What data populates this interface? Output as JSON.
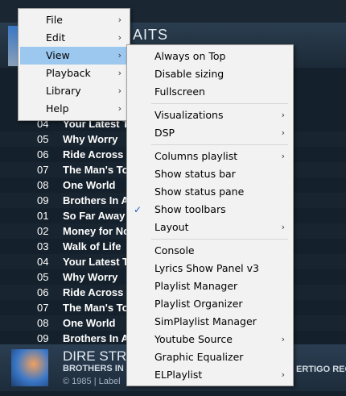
{
  "background": {
    "album_title": "AITS",
    "rows": [
      {
        "num": "04",
        "title": "Your Latest T"
      },
      {
        "num": "05",
        "title": "Why Worry"
      },
      {
        "num": "06",
        "title": "Ride Across T"
      },
      {
        "num": "07",
        "title": "The Man's To"
      },
      {
        "num": "08",
        "title": "One World"
      },
      {
        "num": "09",
        "title": "Brothers In A"
      },
      {
        "num": "01",
        "title": "So Far Away"
      },
      {
        "num": "02",
        "title": "Money for No"
      },
      {
        "num": "03",
        "title": "Walk of Life"
      },
      {
        "num": "04",
        "title": "Your Latest T"
      },
      {
        "num": "05",
        "title": "Why Worry"
      },
      {
        "num": "06",
        "title": "Ride Across T"
      },
      {
        "num": "07",
        "title": "The Man's To"
      },
      {
        "num": "08",
        "title": "One World"
      },
      {
        "num": "09",
        "title": "Brothers In A"
      }
    ],
    "footer": {
      "artist": "DIRE STR",
      "album": "BROTHERS IN",
      "copyright": "© 1985 | Label",
      "label": "ERTIGO RECO"
    }
  },
  "main_menu": {
    "items": [
      {
        "label": "File",
        "arrow": "›"
      },
      {
        "label": "Edit",
        "arrow": "›"
      },
      {
        "label": "View",
        "arrow": "›",
        "selected": true
      },
      {
        "label": "Playback",
        "arrow": "›"
      },
      {
        "label": "Library",
        "arrow": "›"
      },
      {
        "label": "Help",
        "arrow": "›"
      }
    ]
  },
  "view_menu": {
    "items": [
      {
        "label": "Always on Top"
      },
      {
        "label": "Disable sizing"
      },
      {
        "label": "Fullscreen"
      },
      {
        "label": "Visualizations",
        "arrow": "›"
      },
      {
        "label": "DSP",
        "arrow": "›"
      },
      {
        "label": "Columns playlist",
        "arrow": "›"
      },
      {
        "label": "Show status bar"
      },
      {
        "label": "Show status pane"
      },
      {
        "label": "Show toolbars",
        "checked": true
      },
      {
        "label": "Layout",
        "arrow": "›"
      },
      {
        "label": "Console"
      },
      {
        "label": "Lyrics Show Panel v3"
      },
      {
        "label": "Playlist Manager"
      },
      {
        "label": "Playlist Organizer"
      },
      {
        "label": "SimPlaylist Manager"
      },
      {
        "label": "Youtube Source",
        "arrow": "›"
      },
      {
        "label": "Graphic Equalizer"
      },
      {
        "label": "ELPlaylist",
        "arrow": "›"
      }
    ],
    "check_glyph": "✓"
  }
}
